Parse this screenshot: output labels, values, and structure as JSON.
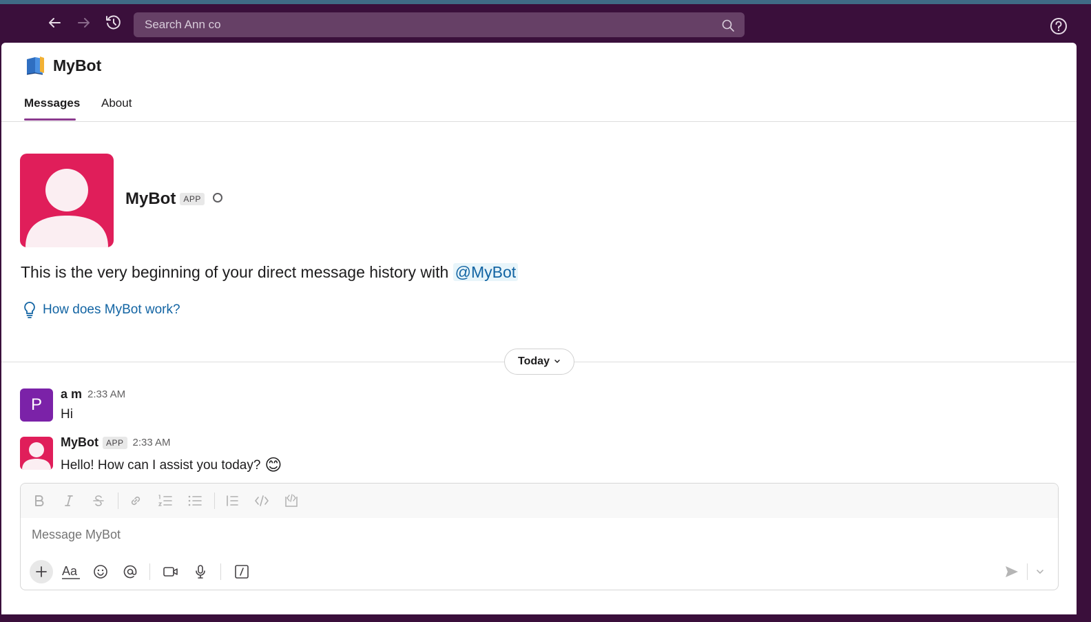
{
  "topbar": {
    "search_placeholder": "Search Ann co"
  },
  "channel": {
    "title": "MyBot",
    "tabs": [
      {
        "label": "Messages",
        "active": true
      },
      {
        "label": "About",
        "active": false
      }
    ]
  },
  "profile": {
    "name": "MyBot",
    "badge": "APP",
    "avatar_color": "#e01e5a"
  },
  "intro": {
    "text": "This is the very beginning of your direct message history with ",
    "mention": "@MyBot",
    "help_link": "How does MyBot work?"
  },
  "date_divider": {
    "label": "Today"
  },
  "messages": [
    {
      "author": "a m",
      "initial": "P",
      "time": "2:33 AM",
      "text": "Hi",
      "avatar_color": "#7b22a8"
    },
    {
      "author": "MyBot",
      "badge": "APP",
      "time": "2:33 AM",
      "text": "Hello! How can I assist you today?",
      "emoji": "😊",
      "avatar_color": "#e01e5a"
    }
  ],
  "composer": {
    "placeholder": "Message MyBot",
    "format_buttons": [
      "bold-icon",
      "italic-icon",
      "strikethrough-icon",
      "link-icon",
      "ordered-list-icon",
      "bulleted-list-icon",
      "blockquote-icon",
      "code-icon",
      "code-block-icon"
    ],
    "toolbar_buttons": [
      "plus-icon",
      "text-format-icon",
      "emoji-icon",
      "mention-icon",
      "video-icon",
      "microphone-icon",
      "slash-command-icon",
      "send-icon",
      "chevron-down-icon"
    ]
  },
  "colors": {
    "sidebar": "#3a0f3b",
    "accent": "#8b3a8e",
    "link": "#1264a3"
  }
}
